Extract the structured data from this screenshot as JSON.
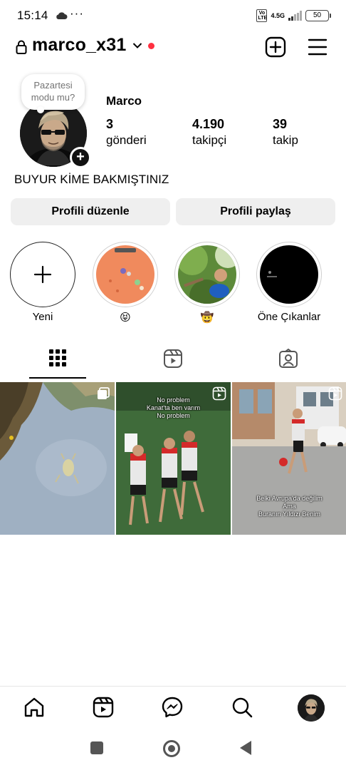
{
  "status_bar": {
    "time": "15:14",
    "dots": "···",
    "volte": "Vo LTE",
    "network": "4.5G",
    "battery": "50"
  },
  "header": {
    "username": "marco_x31",
    "lock_icon": "lock-icon",
    "dropdown_icon": "chevron-down-icon",
    "create_icon": "create-plus-icon",
    "menu_icon": "hamburger-menu-icon",
    "notification_color": "#ff3040"
  },
  "profile": {
    "note": "Pazartesi modu mu?",
    "display_name": "Marco",
    "stats": [
      {
        "value": "3",
        "label": "gönderi"
      },
      {
        "value": "4.190",
        "label": "takipçi"
      },
      {
        "value": "39",
        "label": "takip"
      }
    ],
    "bio": "BUYUR KİME BAKMIŞTINIZ",
    "add_story_badge": "+"
  },
  "buttons": {
    "edit": "Profili düzenle",
    "share": "Profili paylaş"
  },
  "highlights": [
    {
      "label": "Yeni",
      "icon": "plus-icon"
    },
    {
      "label": "😝"
    },
    {
      "label": "🤠"
    },
    {
      "label": "Öne Çıkanlar"
    }
  ],
  "tabs": [
    {
      "name": "posts",
      "icon": "grid-icon",
      "active": true
    },
    {
      "name": "reels",
      "icon": "reels-icon",
      "active": false
    },
    {
      "name": "tagged",
      "icon": "tagged-person-icon",
      "active": false
    }
  ],
  "posts": [
    {
      "type": "carousel",
      "overlay_text": ""
    },
    {
      "type": "reel",
      "overlay_text": "No problem\nKanat'ta ben varım\nNo problem"
    },
    {
      "type": "reel",
      "overlay_text": "Belki Avrupa'da değilim\nAma\nBuranın Yıldızı Benim"
    }
  ],
  "bottom_nav": [
    {
      "name": "home",
      "icon": "home-icon"
    },
    {
      "name": "reels",
      "icon": "reels-icon"
    },
    {
      "name": "messenger",
      "icon": "messenger-icon"
    },
    {
      "name": "search",
      "icon": "search-icon"
    },
    {
      "name": "profile",
      "icon": "profile-avatar-icon"
    }
  ],
  "system_nav": [
    "recents-button",
    "home-button",
    "back-button"
  ]
}
